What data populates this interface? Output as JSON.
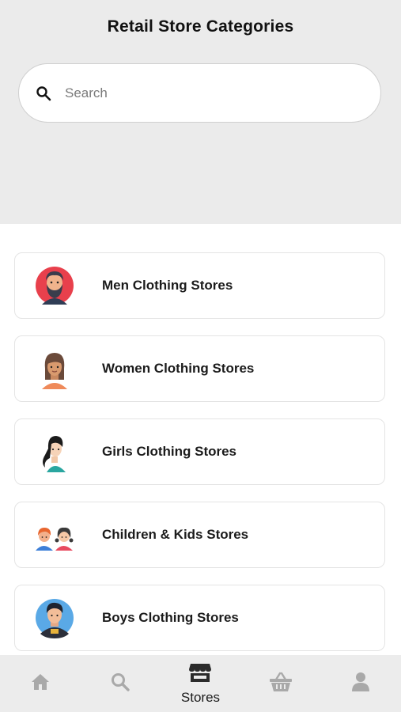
{
  "header": {
    "title": "Retail Store Categories",
    "search": {
      "placeholder": "Search",
      "value": "",
      "icon": "search-icon"
    }
  },
  "categories": [
    {
      "label": "Men Clothing Stores",
      "icon": "man-avatar-icon"
    },
    {
      "label": "Women Clothing Stores",
      "icon": "woman-avatar-icon"
    },
    {
      "label": "Girls Clothing Stores",
      "icon": "girl-avatar-icon"
    },
    {
      "label": "Children & Kids Stores",
      "icon": "kids-avatar-icon"
    },
    {
      "label": "Boys Clothing Stores",
      "icon": "boy-avatar-icon"
    }
  ],
  "tabbar": {
    "active": "stores",
    "items": [
      {
        "id": "home",
        "icon": "home-icon",
        "label": ""
      },
      {
        "id": "search",
        "icon": "search-icon",
        "label": ""
      },
      {
        "id": "stores",
        "icon": "store-icon",
        "label": "Stores"
      },
      {
        "id": "basket",
        "icon": "basket-icon",
        "label": ""
      },
      {
        "id": "profile",
        "icon": "user-icon",
        "label": ""
      }
    ]
  },
  "colors": {
    "header_bg": "#ebebeb",
    "tabbar_bg": "#ececec",
    "tab_inactive": "#a9a9a9",
    "tab_active": "#2b2b2b",
    "card_border": "#e4e4e4"
  }
}
